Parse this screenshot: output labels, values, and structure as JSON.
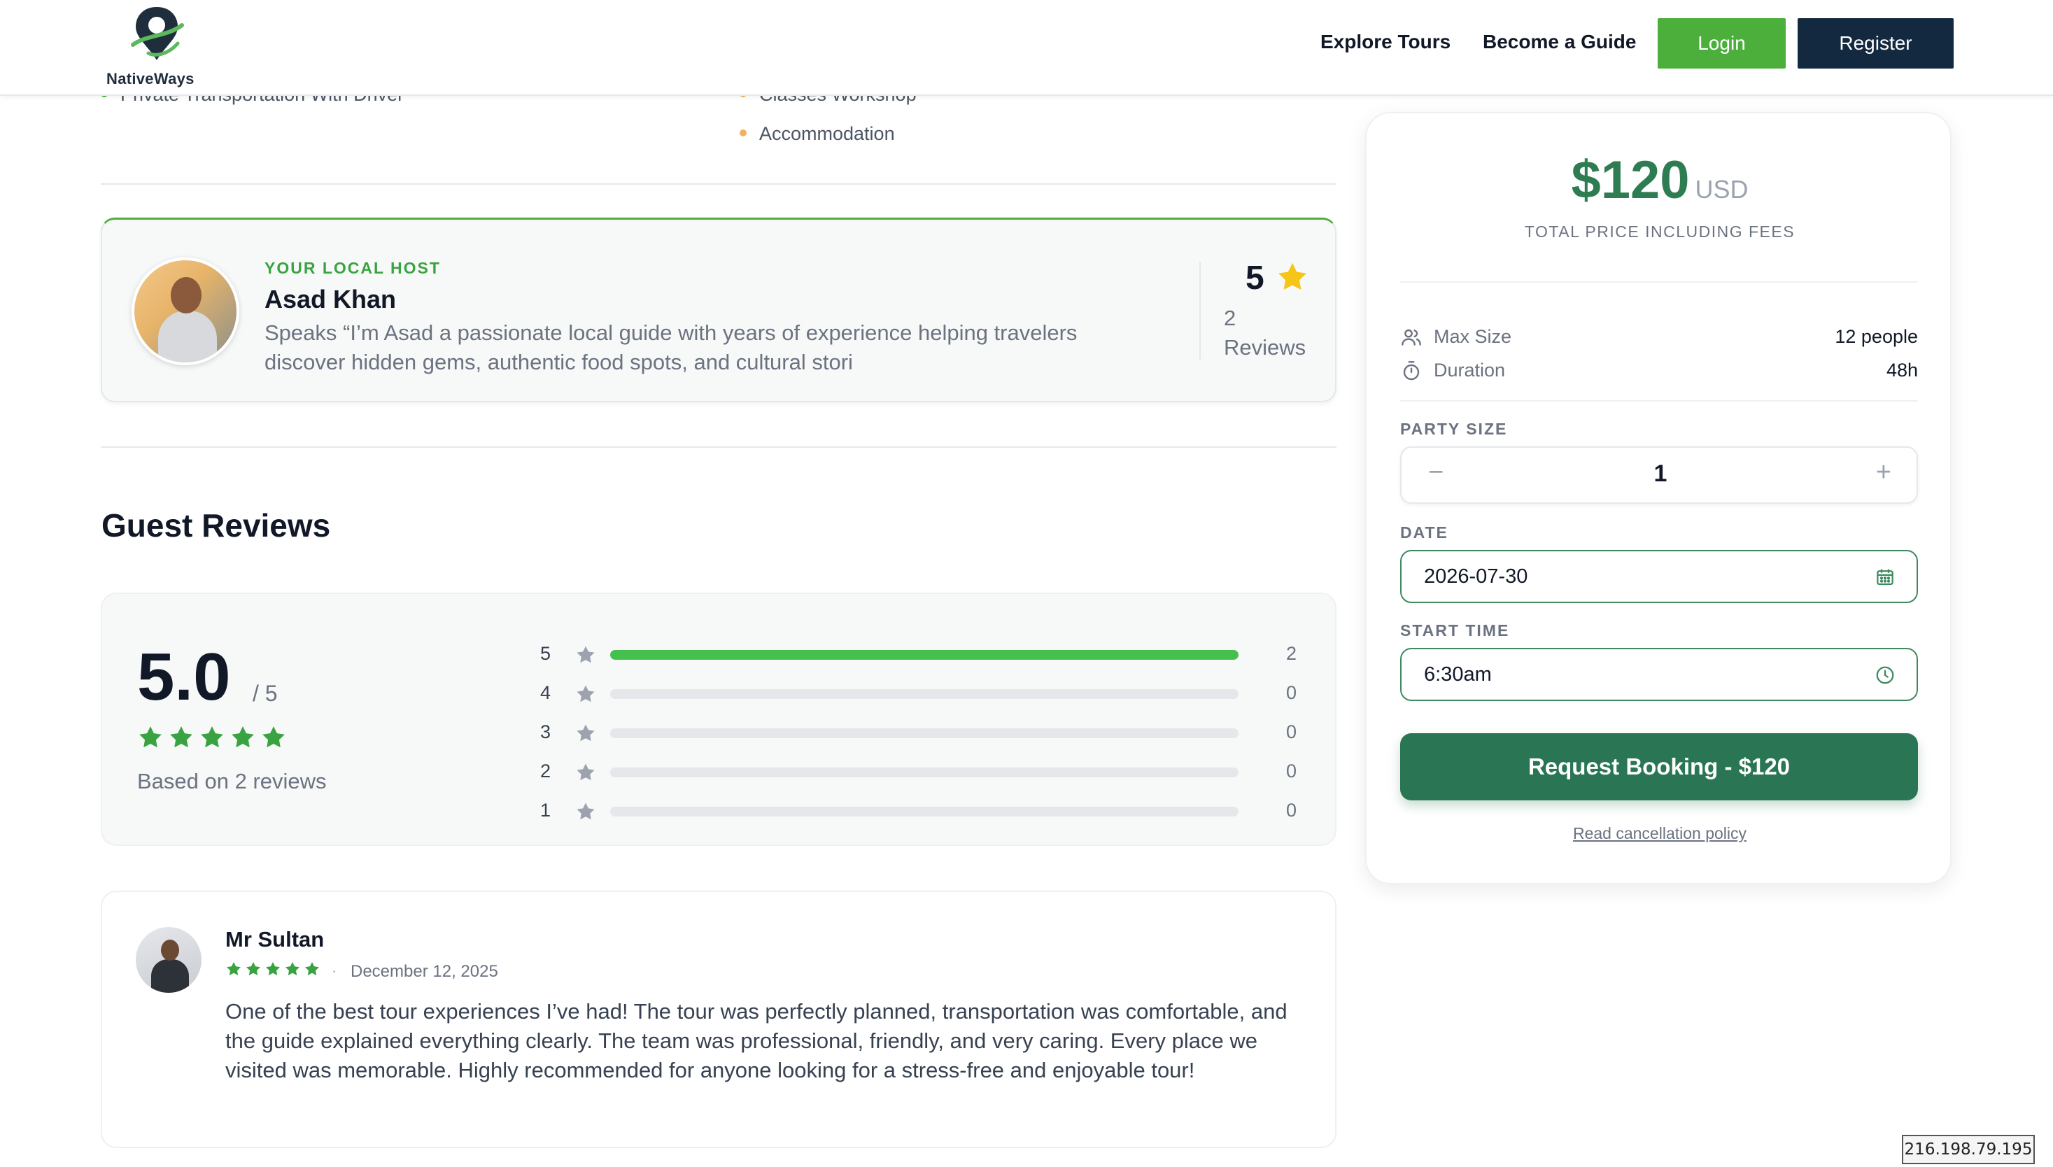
{
  "header": {
    "logo_text": "NativeWays",
    "nav": [
      {
        "label": "Explore Tours"
      },
      {
        "label": "Become a Guide"
      }
    ],
    "login_label": "Login",
    "register_label": "Register"
  },
  "inclusions": {
    "left_partial": "Private Transportation With Driver",
    "right_partial": "Classes Workshop",
    "right_item": "Accommodation"
  },
  "host": {
    "label": "YOUR LOCAL HOST",
    "name": "Asad Khan",
    "bio": "Speaks “I’m Asad a passionate local guide with years of experience helping travelers discover hidden gems, authentic food spots, and cultural stori",
    "rating": "5",
    "reviews_count": "2",
    "reviews_label": "Reviews"
  },
  "reviews_section": {
    "title": "Guest Reviews",
    "average": "5.0",
    "out_of": "/ 5",
    "based_on": "Based on 2 reviews",
    "star_count": 5,
    "distribution": [
      {
        "stars": "5",
        "count": "2",
        "fraction": 1.0
      },
      {
        "stars": "4",
        "count": "0",
        "fraction": 0
      },
      {
        "stars": "3",
        "count": "0",
        "fraction": 0
      },
      {
        "stars": "2",
        "count": "0",
        "fraction": 0
      },
      {
        "stars": "1",
        "count": "0",
        "fraction": 0
      }
    ]
  },
  "review": {
    "name": "Mr Sultan",
    "stars": 5,
    "separator": "·",
    "date": "December 12, 2025",
    "text": "One of the best tour experiences I’ve had! The tour was perfectly planned, transportation was comfortable, and the guide explained everything clearly. The team was professional, friendly, and very caring. Every place we visited was memorable. Highly recommended for anyone looking for a stress-free and enjoyable tour!"
  },
  "booking": {
    "price": "$120",
    "currency": "USD",
    "price_note": "TOTAL PRICE INCLUDING FEES",
    "max_size_label": "Max Size",
    "max_size_value": "12 people",
    "duration_label": "Duration",
    "duration_value": "48h",
    "party_size_label": "PARTY SIZE",
    "party_size_value": "1",
    "minus": "−",
    "plus": "+",
    "date_label": "DATE",
    "date_value": "2026-07-30",
    "start_time_label": "START TIME",
    "start_time_value": "6:30am",
    "book_button": "Request Booking - $120",
    "cancellation_link": "Read cancellation policy"
  },
  "ip_badge": "216.198.79.195",
  "colors": {
    "brand_green": "#4caf3c",
    "dark_navy": "#12293f",
    "booking_green": "#2a7654",
    "star_yellow": "#f5c518",
    "star_green": "#3aa341"
  }
}
